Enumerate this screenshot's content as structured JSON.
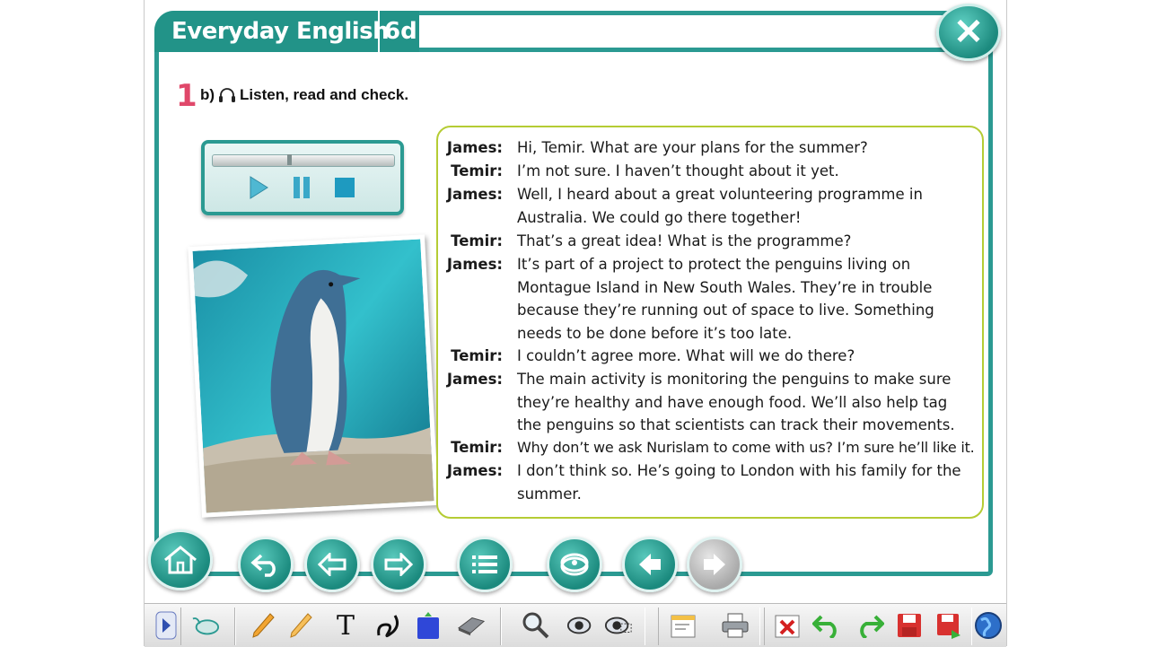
{
  "header": {
    "title": "Everyday English",
    "lesson": "6d"
  },
  "exercise": {
    "number": "1",
    "instruction": "b)",
    "instruction_text": "Listen, read and check."
  },
  "audio_player": {
    "progress": 0.42
  },
  "dialogue": [
    {
      "speaker": "James:",
      "text": "Hi, Temir. What are your plans for the summer?"
    },
    {
      "speaker": "Temir:",
      "text": "I’m not sure. I haven’t thought about it yet."
    },
    {
      "speaker": "James:",
      "text": "Well, I heard about a great volunteering programme in Australia. We could go there together!"
    },
    {
      "speaker": "Temir:",
      "text": "That’s a great idea! What is the programme?"
    },
    {
      "speaker": "James:",
      "text": "It’s part of a project to protect the penguins living on Montague Island in New South Wales. They’re in trouble because they’re running out of space to live. Something needs to be done before it’s too late."
    },
    {
      "speaker": "Temir:",
      "text": "I couldn’t agree more. What will we do there?"
    },
    {
      "speaker": "James:",
      "text": "The main activity is monitoring the penguins to make sure they’re healthy and have enough food. We’ll also help tag the penguins so that scientists can track their movements."
    },
    {
      "speaker": "Temir:",
      "text": "Why don’t we ask Nurislam to come with us? I’m sure he’ll like it."
    },
    {
      "speaker": "James:",
      "text": "I don’t think so. He’s going to London with his family for the summer."
    }
  ],
  "colors": {
    "teal": "#2b9a92",
    "accent_lime": "#b5cc34",
    "exercise_number": "#e0486a"
  },
  "nav_buttons": [
    "home-icon",
    "back-icon",
    "previous-icon",
    "next-icon",
    "menu-list-icon",
    "audio-disc-icon",
    "previous-page-icon",
    "next-page-icon"
  ],
  "tools": [
    "toggle-arrow-icon",
    "mouse-icon",
    "pencil-icon",
    "highlighter-icon",
    "text-tool-icon",
    "freehand-icon",
    "shape-icon",
    "eraser-icon",
    "zoom-icon",
    "spotlight-icon",
    "reveal-icon",
    "whiteboard-icon",
    "print-icon",
    "clear-icon",
    "undo-icon",
    "redo-icon",
    "save-icon",
    "save-as-icon",
    "globe-icon"
  ]
}
